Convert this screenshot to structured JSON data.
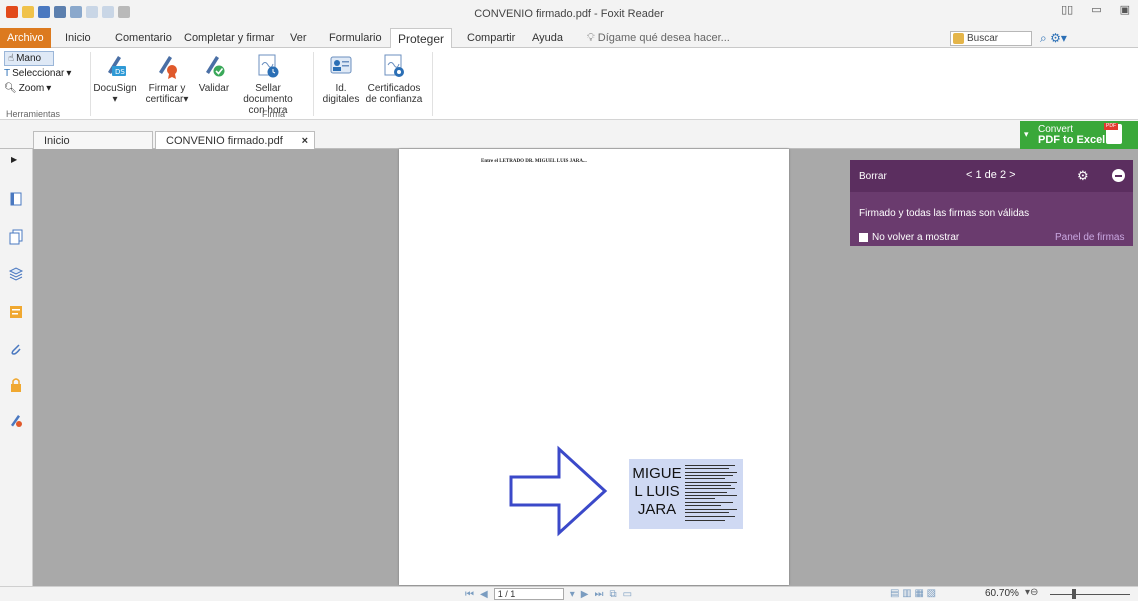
{
  "window": {
    "title": "CONVENIO firmado.pdf - Foxit Reader"
  },
  "menu": {
    "file": "Archivo",
    "tabs": [
      "Inicio",
      "Comentario",
      "Completar y firmar",
      "Ver",
      "Formulario",
      "Proteger",
      "Compartir",
      "Ayuda"
    ],
    "active": "Proteger",
    "tell_me": "Dígame qué desea hacer...",
    "search_placeholder": "Buscar"
  },
  "ribbon": {
    "tools": {
      "hand": "Mano",
      "select": "Seleccionar",
      "zoom": "Zoom",
      "group_label": "Herramientas"
    },
    "buttons": {
      "docusign": "DocuSign",
      "sign_line1": "Firmar y",
      "sign_line2": "certificar",
      "validate": "Validar",
      "timestamp_line1": "Sellar documento",
      "timestamp_line2": "con hora",
      "ids_line1": "Id.",
      "ids_line2": "digitales",
      "certs_line1": "Certificados",
      "certs_line2": "de confianza"
    },
    "firma_group_label": "Firma"
  },
  "doc_tabs": {
    "home": "Inicio",
    "document": "CONVENIO firmado.pdf"
  },
  "convert_banner": {
    "line1": "Convert",
    "line2": "PDF to Excel"
  },
  "page": {
    "header_text": "Entre el LETRADO DR. MIGUEL LUIS JARA...",
    "signature_name_lines": [
      "MIGUE",
      "L LUIS",
      "JARA"
    ]
  },
  "signature_panel": {
    "clear": "Borrar",
    "nav": "< 1 de 2 >",
    "message": "Firmado y todas las firmas son válidas",
    "dont_show": "No volver a mostrar",
    "panel_link": "Panel de firmas"
  },
  "status": {
    "page_indicator": "1 / 1",
    "zoom": "60.70%"
  },
  "colors": {
    "file_tab": "#dc7a1f",
    "signature_panel": "#6a3b6e",
    "convert_banner": "#3aa83a",
    "arrow": "#3b49c9"
  }
}
